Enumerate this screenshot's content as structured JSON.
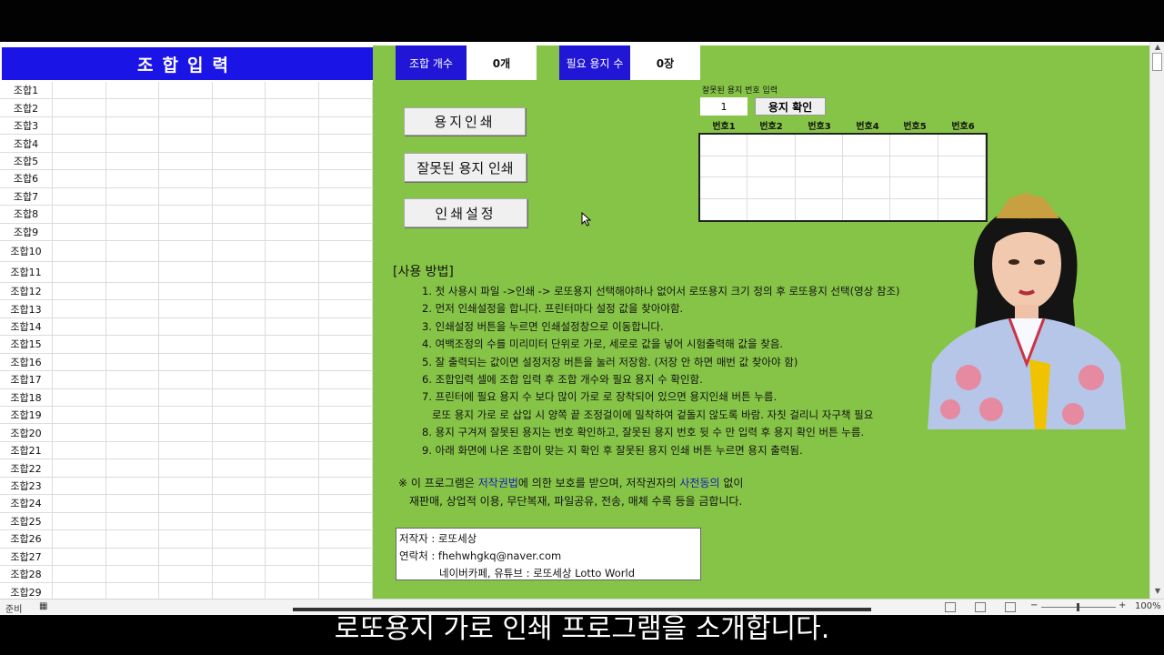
{
  "combo_panel": {
    "header": "조합입력",
    "rows": [
      "조합1",
      "조합2",
      "조합3",
      "조합4",
      "조합5",
      "조합6",
      "조합7",
      "조합8",
      "조합9",
      "조합10",
      "조합11",
      "조합12",
      "조합13",
      "조합14",
      "조합15",
      "조합16",
      "조합17",
      "조합18",
      "조합19",
      "조합20",
      "조합21",
      "조합22",
      "조합23",
      "조합24",
      "조합25",
      "조합26",
      "조합27",
      "조합28",
      "조합29"
    ]
  },
  "counts": {
    "combo_count_label": "조합 개수",
    "combo_count_value": "0개",
    "paper_count_label": "필요 용지 수",
    "paper_count_value": "0장"
  },
  "buttons": {
    "print_paper": "용지인쇄",
    "print_wrong": "잘못된 용지 인쇄",
    "print_settings": "인쇄설정"
  },
  "wrong_paper": {
    "title": "잘못된 용지 번호 입력",
    "input_value": "1",
    "confirm_button": "용지 확인",
    "columns": [
      "번호1",
      "번호2",
      "번호3",
      "번호4",
      "번호5",
      "번호6"
    ]
  },
  "usage": {
    "title": "[사용 방법]",
    "lines": [
      "1. 첫 사용시 파일 ->인쇄 -> 로또용지 선택해야하나 없어서 로또용지 크기 정의 후 로또용지 선택(영상 참조)",
      "2. 먼저 인쇄설정을 합니다. 프린터마다 설정 값을 찾아야함.",
      "3. 인쇄설정 버튼을 누르면 인쇄설정창으로 이동합니다.",
      "4. 여백조정의 수를 미리미터 단위로 가로, 세로로 값을 넣어 시험출력해 값을 찾음.",
      "5. 잘 출력되는 값이면 설정저장 버튼을 눌러 저장함. (저장 안 하면 매번 값 찾아야 함)",
      "6. 조합입력 셀에 조합 입력 후 조합 개수와 필요 용지 수 확인함.",
      "7. 프린터에 필요 용지 수 보다 많이 가로 로 장착되어 있으면 용지인쇄 버튼 누름.",
      "   로또 용지 가로 로 삽입 시 양쪽 끝 조정걸이에 밀착하여 겉돌지 않도록 바람. 자칫 걸리니 자구책 필요",
      "8. 용지 구겨져 잘못된 용지는 번호 확인하고, 잘못된 용지 번호 뒷 수 만 입력 후 용지 확인 버튼 누름.",
      "9. 아래 화면에 나온 조합이 맞는 지 확인 후 잘못된 용지 인쇄 버튼 누르면 용지 출력됨."
    ]
  },
  "notice": {
    "line1_a": "※ 이 프로그램은 ",
    "line1_b": "저작권법",
    "line1_c": "에 의한 보호를 받으며, 저작권자의 ",
    "line1_d": "사전동의",
    "line1_e": " 없이",
    "line2": "재판매, 상업적 이용, 무단복재, 파일공유, 전송, 매체 수록 등을 금합니다."
  },
  "author": {
    "author_line": "저작자 : 로또세상",
    "contact_line": "연락처 : fhehwhgkq@naver.com",
    "channel_line": "네이버카페, 유튜브 : 로또세상 Lotto World"
  },
  "status": {
    "ready": "준비",
    "zoom": "100%"
  },
  "subtitle": "로또용지 가로 인쇄 프로그램을 소개합니다.",
  "colors": {
    "green_bg": "#86c447",
    "blue_tag": "#2116d6",
    "header_blue": "#1a14e6"
  }
}
